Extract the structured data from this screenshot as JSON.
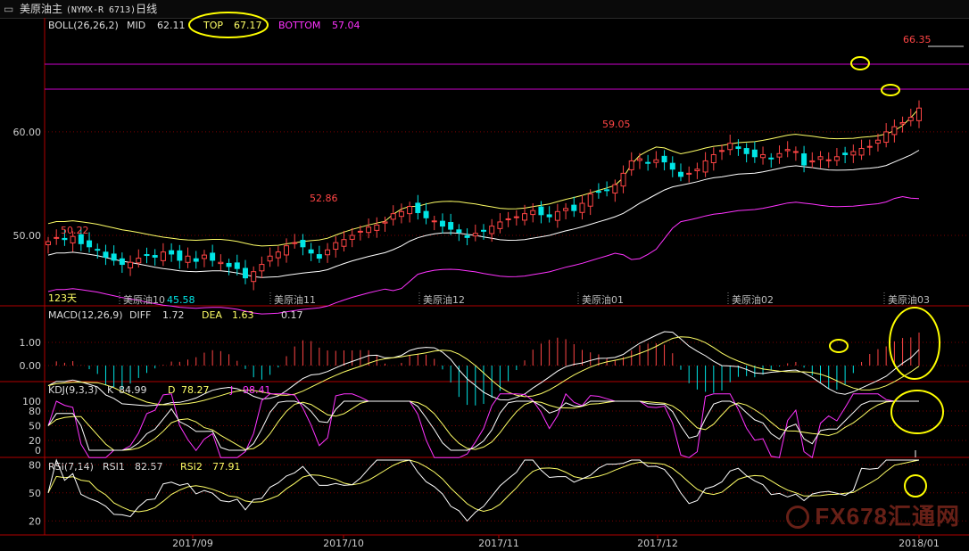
{
  "window": {
    "title": "美原油主",
    "code": "(NYMX-R 6713)",
    "period": "日线"
  },
  "boll": {
    "label": "BOLL(26,26,2)",
    "mid_label": "MID",
    "mid": "62.11",
    "top_label": "TOP",
    "top": "67.17",
    "bottom_label": "BOTTOM",
    "bottom": "57.04"
  },
  "macd": {
    "label": "MACD(12,26,9)",
    "diff_label": "DIFF",
    "diff": "1.72",
    "dea_label": "DEA",
    "dea": "1.63",
    "macd": "0.17"
  },
  "kdj": {
    "label": "KDJ(9,3,3)",
    "k_label": "K",
    "k": "84.99",
    "d_label": "D",
    "d": "78.27",
    "j_label": "J",
    "j": "98.41"
  },
  "rsi": {
    "label": "RSI(7,14)",
    "rsi1_label": "RSI1",
    "rsi1": "82.57",
    "rsi2_label": "RSI2",
    "rsi2": "77.91"
  },
  "days_label": "123天",
  "contract_labels": [
    "美原油10",
    "美原油11",
    "美原油12",
    "美原油01",
    "美原油02",
    "美原油03"
  ],
  "watermark": "FX678汇通网",
  "colors": {
    "up": "#ff4545",
    "down": "#00e5e5",
    "mid": "#ffffff",
    "top": "#ffff66",
    "bottom": "#ff33ff",
    "resistance": "#cc00cc",
    "annotation": "#ffff00"
  },
  "chart_data": {
    "type": "candlestick",
    "dates": [
      "2017-08-15",
      "2017-08-16",
      "2017-08-17",
      "2017-08-18",
      "2017-08-21",
      "2017-08-22",
      "2017-08-23",
      "2017-08-24",
      "2017-08-25",
      "2017-08-28",
      "2017-08-29",
      "2017-08-30",
      "2017-08-31",
      "2017-09-01",
      "2017-09-05",
      "2017-09-06",
      "2017-09-07",
      "2017-09-08",
      "2017-09-11",
      "2017-09-12",
      "2017-09-13",
      "2017-09-14",
      "2017-09-15",
      "2017-09-18",
      "2017-09-19",
      "2017-09-20",
      "2017-09-21",
      "2017-09-22",
      "2017-09-25",
      "2017-09-26",
      "2017-09-27",
      "2017-09-28",
      "2017-09-29",
      "2017-10-02",
      "2017-10-03",
      "2017-10-04",
      "2017-10-05",
      "2017-10-06",
      "2017-10-09",
      "2017-10-10",
      "2017-10-11",
      "2017-10-12",
      "2017-10-13",
      "2017-10-16",
      "2017-10-17",
      "2017-10-18",
      "2017-10-19",
      "2017-10-20",
      "2017-10-23",
      "2017-10-24",
      "2017-10-25",
      "2017-10-26",
      "2017-10-27",
      "2017-10-30",
      "2017-10-31",
      "2017-11-01",
      "2017-11-02",
      "2017-11-03",
      "2017-11-06",
      "2017-11-07",
      "2017-11-08",
      "2017-11-09",
      "2017-11-10",
      "2017-11-13",
      "2017-11-14",
      "2017-11-15",
      "2017-11-16",
      "2017-11-17",
      "2017-11-20",
      "2017-11-21",
      "2017-11-22",
      "2017-11-24",
      "2017-11-27",
      "2017-11-28",
      "2017-11-29",
      "2017-11-30",
      "2017-12-01",
      "2017-12-04",
      "2017-12-05",
      "2017-12-06",
      "2017-12-07",
      "2017-12-08",
      "2017-12-11",
      "2017-12-12",
      "2017-12-13",
      "2017-12-14",
      "2017-12-15",
      "2017-12-18",
      "2017-12-19",
      "2017-12-20",
      "2017-12-21",
      "2017-12-22",
      "2017-12-26",
      "2017-12-27",
      "2017-12-28",
      "2017-12-29",
      "2018-01-02",
      "2018-01-03",
      "2018-01-04",
      "2018-01-05",
      "2018-01-08",
      "2018-01-09",
      "2018-01-10",
      "2018-01-11",
      "2018-01-12",
      "2018-01-16",
      "2018-01-17"
    ],
    "close": [
      49.4,
      49.8,
      49.6,
      49.9,
      49.2,
      48.9,
      48.6,
      47.9,
      47.6,
      47.2,
      47.4,
      47.8,
      48.1,
      47.9,
      48.4,
      48.2,
      47.6,
      48.0,
      47.5,
      48.1,
      47.6,
      47.4,
      47.0,
      46.8,
      45.9,
      46.5,
      47.2,
      48.0,
      48.4,
      49.0,
      49.3,
      48.9,
      48.3,
      47.8,
      48.6,
      49.3,
      49.6,
      50.0,
      50.4,
      50.8,
      51.0,
      51.3,
      52.1,
      52.3,
      52.8,
      52.2,
      51.7,
      51.4,
      50.9,
      50.6,
      50.3,
      49.8,
      50.2,
      50.4,
      50.9,
      51.3,
      51.6,
      51.8,
      52.1,
      52.4,
      52.0,
      51.8,
      52.3,
      52.6,
      52.4,
      53.1,
      54.0,
      54.2,
      54.4,
      54.9,
      56.0,
      57.2,
      57.4,
      57.0,
      57.3,
      57.1,
      56.4,
      55.7,
      56.0,
      56.4,
      57.2,
      57.8,
      58.2,
      58.9,
      58.4,
      57.9,
      57.6,
      57.8,
      57.4,
      57.9,
      58.3,
      58.1,
      56.8,
      57.2,
      57.6,
      57.3,
      57.6,
      57.8,
      58.1,
      58.4,
      58.6,
      59.2,
      60.0,
      60.5,
      60.9,
      61.4,
      62.3
    ]
  },
  "y_ticks": {
    "main": [
      "60.00",
      "50.00"
    ],
    "macd": [
      "1.00",
      "0.00"
    ],
    "kdj": [
      "100",
      "80",
      "50",
      "20",
      "0"
    ],
    "rsi": [
      "80",
      "50",
      "20"
    ]
  },
  "x_ticks": [
    "2017/09",
    "2017/10",
    "2017/11",
    "2017/12",
    "2018/01"
  ],
  "annotations": {
    "high_1": "50.22",
    "high_2": "52.86",
    "high_3": "59.05",
    "high_4": "66.35",
    "low_1": "45.58"
  }
}
